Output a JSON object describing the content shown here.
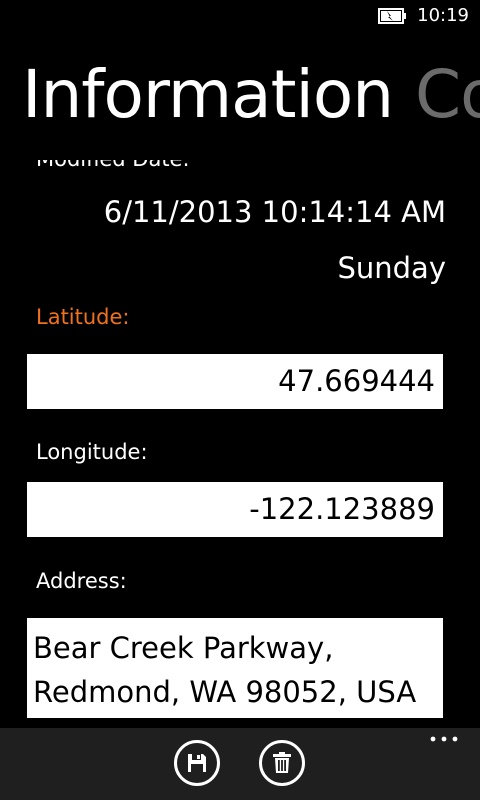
{
  "status_bar": {
    "time": "10:19",
    "battery_icon": "battery-charging-icon"
  },
  "pivot": {
    "active_title": "Information",
    "next_title": "Co"
  },
  "details": {
    "modified_label": "Modified Date:",
    "modified_value": "6/11/2013 10:14:14 AM",
    "day_value": "Sunday",
    "latitude_label": "Latitude:",
    "latitude_value": "47.669444",
    "longitude_label": "Longitude:",
    "longitude_value": "-122.123889",
    "address_label": "Address:",
    "address_line1": "Bear Creek Parkway,",
    "address_line2": "Redmond, WA 98052, USA"
  },
  "app_bar": {
    "buttons": [
      "save-icon",
      "delete-icon"
    ],
    "more": "ellipsis-icon"
  },
  "colors": {
    "accent": "#f0711e",
    "background": "#000000",
    "app_bar": "#1f1f1f"
  }
}
